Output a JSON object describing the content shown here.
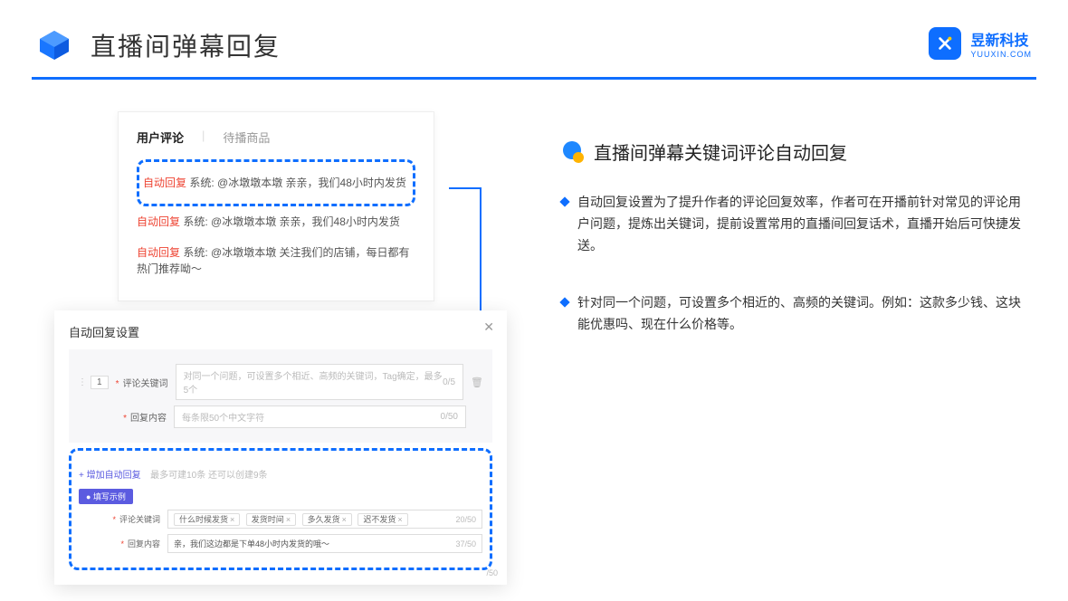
{
  "header": {
    "title": "直播间弹幕回复"
  },
  "logo": {
    "main": "昱新科技",
    "sub": "YUUXIN.COM"
  },
  "comments": {
    "tab_active": "用户评论",
    "tab_inactive": "待播商品",
    "items": [
      {
        "tag": "自动回复",
        "text": "系统: @冰墩墩本墩 亲亲，我们48小时内发货"
      },
      {
        "tag": "自动回复",
        "text": "系统: @冰墩墩本墩 亲亲，我们48小时内发货"
      },
      {
        "tag": "自动回复",
        "text": "系统: @冰墩墩本墩 关注我们的店铺，每日都有热门推荐呦～"
      }
    ]
  },
  "modal": {
    "title": "自动回复设置",
    "row_num": "1",
    "label_keyword": "评论关键词",
    "label_reply": "回复内容",
    "keyword_placeholder": "对同一个问题，可设置多个相近、高频的关键词，Tag确定，最多5个",
    "keyword_counter": "0/5",
    "reply_placeholder": "每条限50个中文字符",
    "reply_counter": "0/50",
    "add_link": "+ 增加自动回复",
    "add_hint": "最多可建10条 还可以创建9条",
    "example_badge": "● 填写示例",
    "example_tags": [
      "什么时候发货",
      "发货时间",
      "多久发货",
      "迟不发货"
    ],
    "example_tag_counter": "20/50",
    "example_reply": "亲，我们这边都是下单48小时内发货的哦～",
    "example_reply_counter": "37/50",
    "outer_counter": "/50"
  },
  "right": {
    "title": "直播间弹幕关键词评论自动回复",
    "bullets": [
      "自动回复设置为了提升作者的评论回复效率，作者可在开播前针对常见的评论用户问题，提炼出关键词，提前设置常用的直播间回复话术，直播开始后可快捷发送。",
      "针对同一个问题，可设置多个相近的、高频的关键词。例如：这款多少钱、这块能优惠吗、现在什么价格等。"
    ]
  }
}
